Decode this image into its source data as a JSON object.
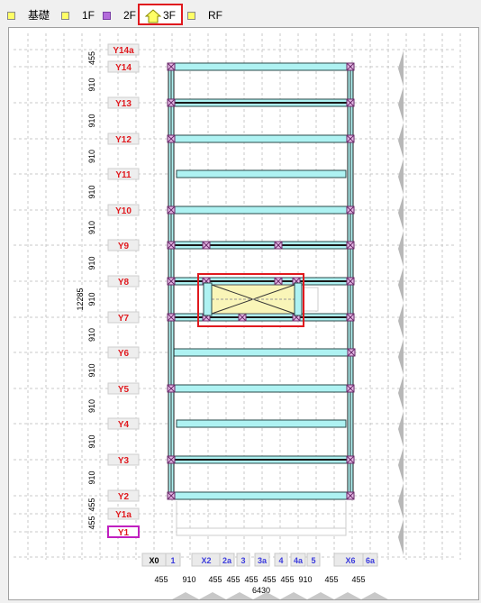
{
  "tabs": [
    {
      "label": "基礎",
      "icon": "yellow-square-icon",
      "color": "#ffff66"
    },
    {
      "label": "1F",
      "icon": "yellow-square-icon",
      "color": "#ffff66"
    },
    {
      "label": "2F",
      "icon": "purple-square-icon",
      "color": "#b36bdb"
    },
    {
      "label": "3F",
      "icon": "house-icon",
      "color": "#ffff66",
      "active": true
    },
    {
      "label": "RF",
      "icon": "yellow-square-icon",
      "color": "#ffff66"
    }
  ],
  "y_axis": {
    "labels": [
      "Y14a",
      "Y14",
      "Y13",
      "Y12",
      "Y11",
      "Y10",
      "Y9",
      "Y8",
      "Y7",
      "Y6",
      "Y5",
      "Y4",
      "Y3",
      "Y2",
      "Y1a",
      "Y1"
    ],
    "selected": "Y1",
    "dims": [
      "455",
      "910",
      "910",
      "910",
      "910",
      "910",
      "910",
      "910",
      "910",
      "910",
      "910",
      "910",
      "910",
      "455",
      "455"
    ],
    "total": "12285"
  },
  "x_axis": {
    "labels": [
      "X0",
      "1",
      "X2",
      "2a",
      "3",
      "3a",
      "4",
      "4a",
      "5",
      "X6",
      "6a"
    ],
    "dims": [
      "455",
      "910",
      "455",
      "455",
      "455",
      "455",
      "455",
      "910",
      "455"
    ],
    "total": "6430"
  },
  "colors": {
    "accent": "#e0191e",
    "beam": "#aef2f2",
    "node": "#e5b8e5",
    "opening": "#f9f5b8"
  }
}
